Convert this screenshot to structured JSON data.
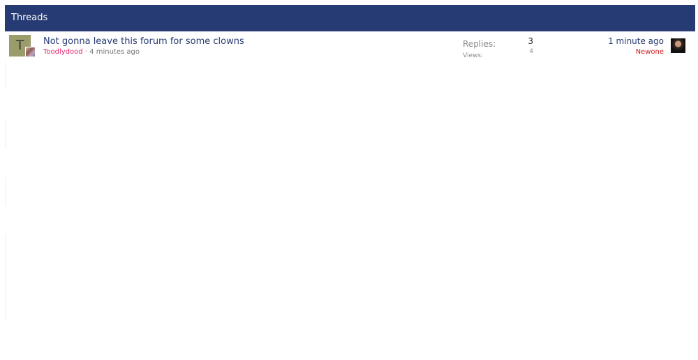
{
  "block": {
    "header_title": "Threads"
  },
  "threads": [
    {
      "avatar_letter": "T",
      "title": "Not gonna leave this forum for some clowns",
      "author": "Toodlydood",
      "separator": " · ",
      "started": "4 minutes ago",
      "replies_label": "Replies:",
      "replies_value": "3",
      "views_label": "Views:",
      "views_value": "4",
      "last_post_time": "1 minute ago",
      "last_poster": "Newone"
    }
  ],
  "colors": {
    "header_bg": "#263b74",
    "title_link": "#263b74",
    "author_link": "#e0276f",
    "last_poster_link": "#cc1f1f"
  },
  "icons": {
    "avatar": "letter-avatar",
    "mini_avatar": "user-photo-avatar",
    "last_poster_avatar": "user-photo-avatar"
  }
}
